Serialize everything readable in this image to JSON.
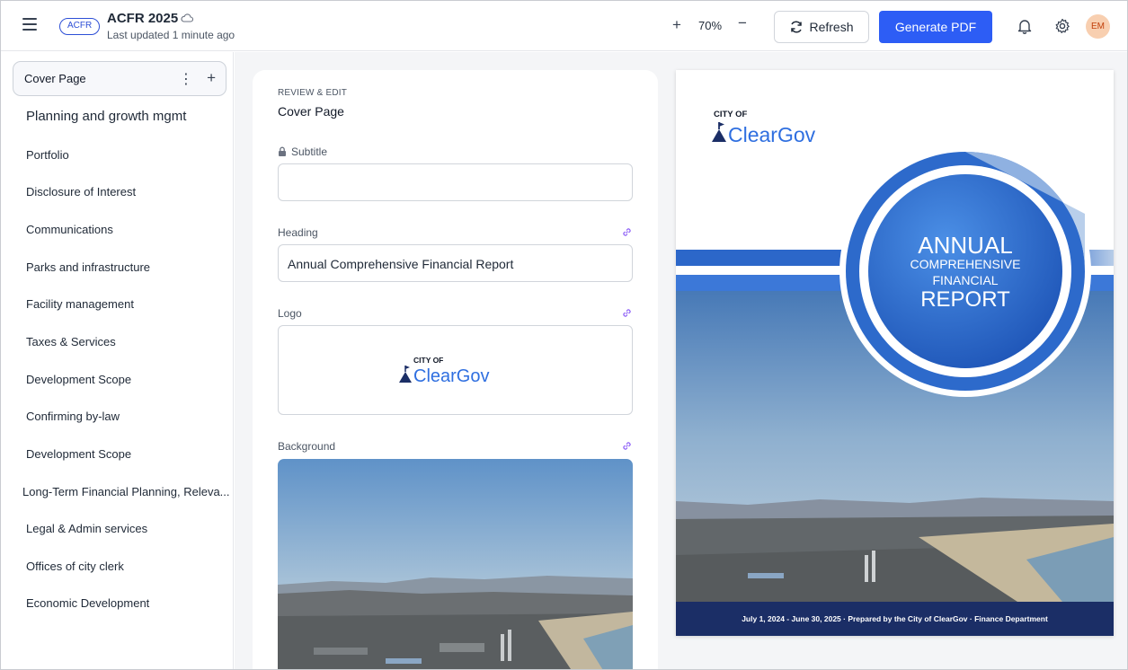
{
  "header": {
    "badge": "ACFR",
    "title": "ACFR 2025",
    "updated": "Last updated 1 minute ago",
    "zoom": "70%",
    "refresh_label": "Refresh",
    "generate_label": "Generate PDF",
    "avatar_initials": "EM"
  },
  "sidebar": {
    "active": "Cover Page",
    "items": [
      "Planning and growth mgmt",
      "Portfolio",
      "Disclosure of Interest",
      "Communications",
      "Parks and infrastructure",
      "Facility management",
      "Taxes & Services",
      "Development Scope",
      "Confirming by-law",
      "Development Scope",
      "Long-Term Financial Planning, Releva...",
      "Legal & Admin services",
      "Offices of city clerk",
      "Economic Development"
    ]
  },
  "editor": {
    "section_label": "REVIEW & EDIT",
    "section_title": "Cover Page",
    "subtitle_label": "Subtitle",
    "subtitle_value": "",
    "heading_label": "Heading",
    "heading_value": "Annual Comprehensive Financial Report",
    "logo_label": "Logo",
    "background_label": "Background"
  },
  "logo": {
    "city_of": "CITY OF",
    "name": "ClearGov"
  },
  "preview": {
    "annual": "ANNUAL",
    "comprehensive": "COMPREHENSIVE",
    "financial": "FINANCIAL",
    "report": "REPORT",
    "footer": "July 1, 2024 - June 30, 2025 · Prepared by the City of ClearGov · Finance Department"
  },
  "colors": {
    "accent": "#2d5df5",
    "brand_blue": "#2f6fe0",
    "navy": "#1b2e66"
  }
}
